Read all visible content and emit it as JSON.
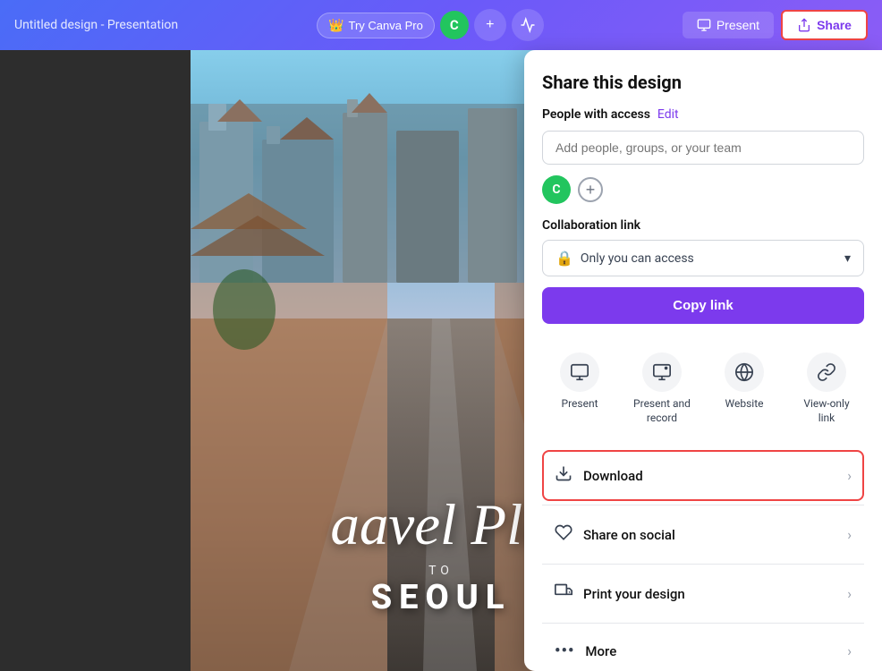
{
  "topbar": {
    "title": "Untitled design - Presentation",
    "tryCanvaPro": "Try Canva Pro",
    "avatarLetter": "C",
    "presentLabel": "Present",
    "shareLabel": "Share"
  },
  "slide": {
    "mainText": "avel Pla",
    "leftText": "a",
    "subLabel": "TO",
    "cityName": "Seoul"
  },
  "panel": {
    "title": "Share this design",
    "peopleWithAccess": "People with access",
    "editLabel": "Edit",
    "inputPlaceholder": "Add people, groups, or your team",
    "avatarLetter": "C",
    "collaborationLink": "Collaboration link",
    "accessText": "Only you can access",
    "copyLinkLabel": "Copy link",
    "shareOptions": [
      {
        "id": "present",
        "label": "Present",
        "icon": "🖥"
      },
      {
        "id": "present-record",
        "label": "Present and record",
        "icon": "📹"
      },
      {
        "id": "website",
        "label": "Website",
        "icon": "🌐"
      },
      {
        "id": "view-only",
        "label": "View-only link",
        "icon": "🔗"
      }
    ],
    "listOptions": [
      {
        "id": "download",
        "label": "Download",
        "icon": "⬇",
        "highlighted": true
      },
      {
        "id": "share-social",
        "label": "Share on social",
        "icon": "♥",
        "highlighted": false
      },
      {
        "id": "print",
        "label": "Print your design",
        "icon": "🚚",
        "highlighted": false
      },
      {
        "id": "more",
        "label": "More",
        "icon": "•••",
        "highlighted": false
      }
    ]
  }
}
